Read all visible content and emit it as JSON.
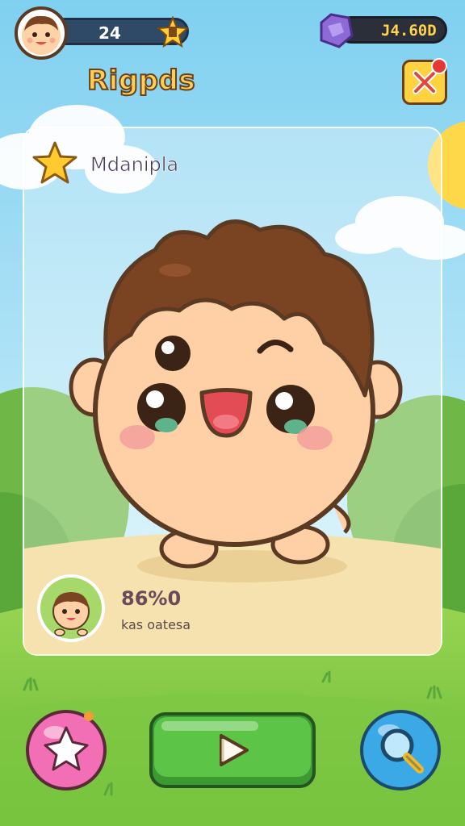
{
  "hud": {
    "level": "24",
    "coins": "J4.60D"
  },
  "header": {
    "title": "Rigpds"
  },
  "card": {
    "title": "Mdanipla",
    "stat_percent": "86%0",
    "stat_subtitle": "kas oatesa"
  },
  "colors": {
    "sky_top": "#8fd6f2",
    "grass": "#86cf47",
    "play_button": "#5cc548",
    "pink_button": "#f26fb5",
    "blue_button": "#3aa9e6",
    "gold": "#ffcf57",
    "outline": "#5a3a22"
  },
  "icons": {
    "level_badge": "star-badge-icon",
    "coin": "purple-gem-icon",
    "close": "close-icon",
    "card_badge": "star-icon",
    "play": "play-icon",
    "left_button": "star-icon",
    "right_button": "search-icon"
  }
}
